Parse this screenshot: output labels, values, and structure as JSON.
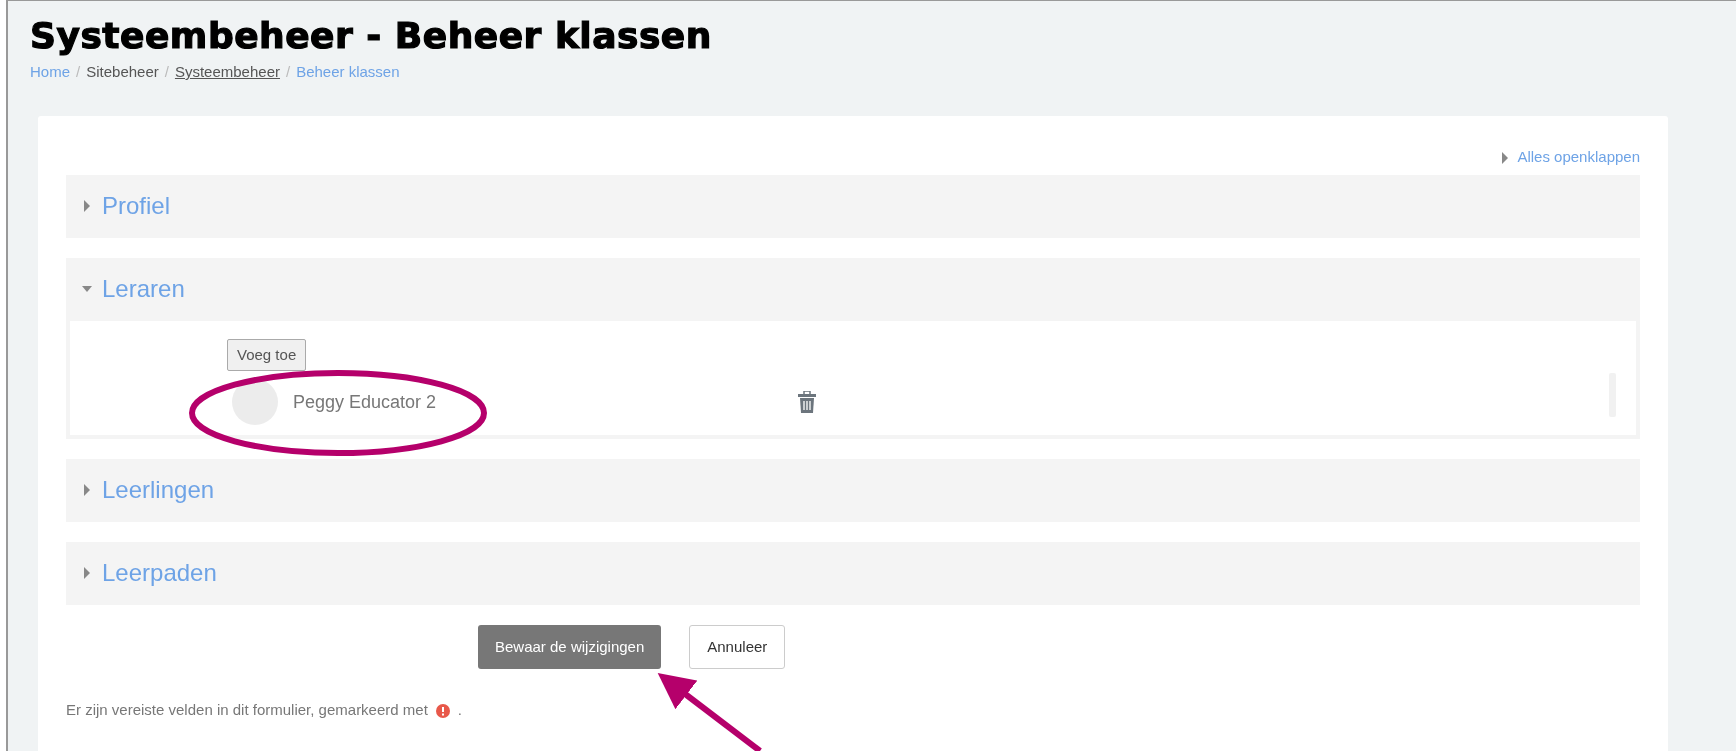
{
  "page": {
    "title": "Systeembeheer - Beheer klassen"
  },
  "breadcrumb_separator": "/",
  "breadcrumb": [
    {
      "label": "Home",
      "kind": "link"
    },
    {
      "label": "Sitebeheer",
      "kind": "text"
    },
    {
      "label": "Systeembeheer",
      "kind": "underlined"
    },
    {
      "label": "Beheer klassen",
      "kind": "link"
    }
  ],
  "expand_all": "Alles openklappen",
  "sections": [
    {
      "title": "Profiel",
      "expanded": false
    },
    {
      "title": "Leraren",
      "expanded": true,
      "add_button": "Voeg toe",
      "members": [
        {
          "name": "Peggy Educator 2"
        }
      ]
    },
    {
      "title": "Leerlingen",
      "expanded": false
    },
    {
      "title": "Leerpaden",
      "expanded": false
    }
  ],
  "buttons": [
    {
      "label": "Bewaar de wijzigingen",
      "kind": "primary"
    },
    {
      "label": "Annuleer",
      "kind": "secondary"
    }
  ],
  "required_note": {
    "text": "Er zijn vereiste velden in dit formulier, gemarkeerd met",
    "suffix": "."
  }
}
